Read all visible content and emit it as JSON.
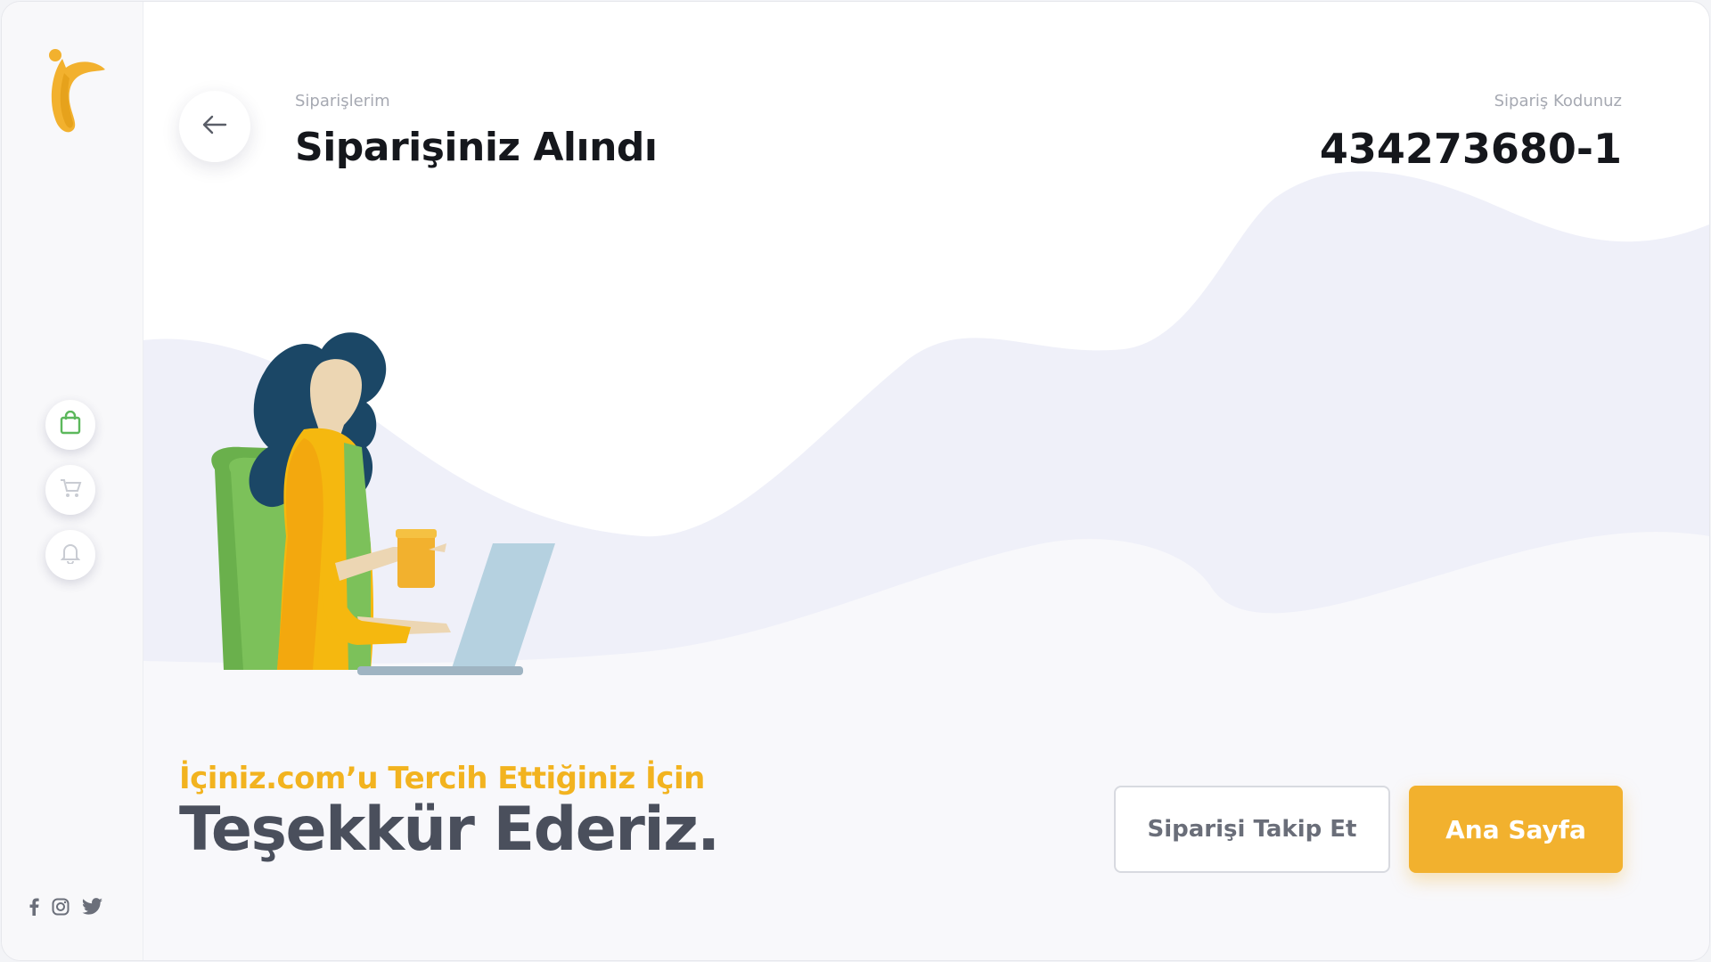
{
  "breadcrumb": "Siparişlerim",
  "page_title": "Siparişiniz Alındı",
  "order": {
    "code_label": "Sipariş Kodunuz",
    "code_value": "434273680-1"
  },
  "thanks": {
    "subtitle": "İçiniz.com’u Tercih Ettiğiniz İçin",
    "title": "Teşekkür Ederiz."
  },
  "buttons": {
    "track_order": "Siparişi Takip Et",
    "home": "Ana Sayfa"
  },
  "sidebar": {
    "items": [
      {
        "icon": "shopping-bag-icon",
        "active": true
      },
      {
        "icon": "cart-icon",
        "active": false
      },
      {
        "icon": "bell-icon",
        "active": false
      }
    ],
    "social": [
      "facebook-icon",
      "instagram-icon",
      "twitter-icon"
    ]
  },
  "colors": {
    "accent": "#f2b12e",
    "active_icon": "#5cb85c",
    "text_dark": "#15171c",
    "text_muted": "#a6a9b2",
    "wave": "#eef0f8"
  }
}
